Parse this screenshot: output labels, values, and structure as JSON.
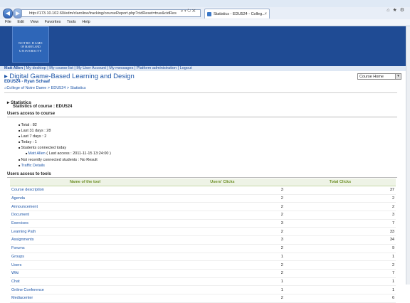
{
  "browser": {
    "url": "http://173.10.102.60/edm/claroline/tracking/courseReport.php?cidReset=true&cidRes",
    "tab_title": "Statistics - EDU524 - Colleg...",
    "menu": [
      "File",
      "Edit",
      "View",
      "Favorites",
      "Tools",
      "Help"
    ]
  },
  "banner": {
    "logo_line1": "NOTRE DAME",
    "logo_line2": "OF MARYLAND",
    "logo_line3": "UNIVERSITY"
  },
  "user_nav": {
    "user": "Matt Allen",
    "items": [
      "My desktop",
      "My course list",
      "My User Account",
      "My messages",
      "Platform administration",
      "Logout"
    ]
  },
  "course": {
    "title": "Digital Game-Based Learning and Design",
    "subtitle": "EDU524 - Ryan Schaaf",
    "select_value": "Course Home"
  },
  "breadcrumb": [
    "College of Notre Dame",
    "EDU524",
    "Statistics"
  ],
  "stats": {
    "title": "Statistics",
    "subtitle": "Statistics of course : EDU524",
    "access_header": "Users access to course",
    "total": "Total : 82",
    "last31": "Last 31 days : 28",
    "last7": "Last 7 days : 2",
    "today": "Today : 1",
    "connected_today": "Students connected today",
    "connected_user": "Matt Allen",
    "connected_detail": "( Last access : 2011-11-15 13:24:00 )",
    "not_connected": "Not recently connected students : No Result",
    "traffic_link": "Traffic Details"
  },
  "tools": {
    "header": "Users access to tools",
    "columns": [
      "Name of the tool",
      "Users' Clicks",
      "Total Clicks"
    ],
    "rows": [
      [
        "Course description",
        "3",
        "37"
      ],
      [
        "Agenda",
        "2",
        "2"
      ],
      [
        "Announcement",
        "2",
        "2"
      ],
      [
        "Document",
        "2",
        "3"
      ],
      [
        "Exercises",
        "3",
        "7"
      ],
      [
        "Learning Path",
        "2",
        "33"
      ],
      [
        "Assignments",
        "3",
        "34"
      ],
      [
        "Forums",
        "2",
        "9"
      ],
      [
        "Groups",
        "1",
        "1"
      ],
      [
        "Users",
        "2",
        "2"
      ],
      [
        "Wiki",
        "2",
        "7"
      ],
      [
        "Chat",
        "1",
        "1"
      ],
      [
        "Online Conference",
        "1",
        "1"
      ],
      [
        "Mediacenter",
        "2",
        "6"
      ]
    ]
  },
  "colors": {
    "banner": "#1f4b94",
    "link": "#1e56a8",
    "table_header": "#6b8e23"
  }
}
